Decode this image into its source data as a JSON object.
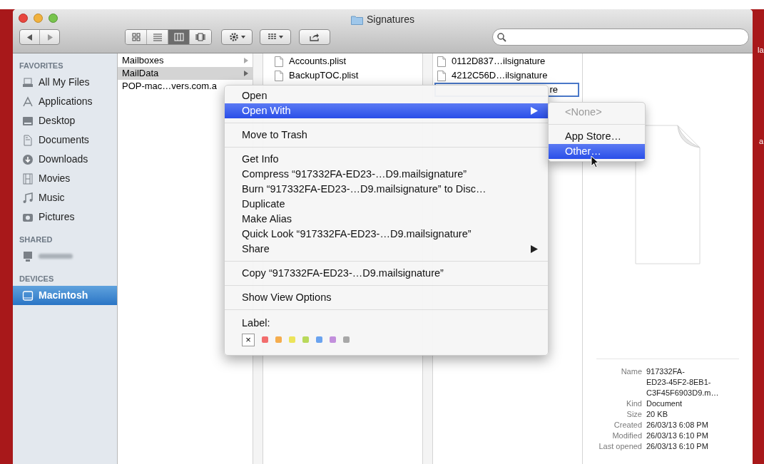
{
  "window": {
    "title": "Signatures"
  },
  "desktop_labels": [
    "la",
    "a"
  ],
  "toolbar": {
    "view_modes": [
      {
        "kind": "icons",
        "selected": false
      },
      {
        "kind": "list",
        "selected": false
      },
      {
        "kind": "columns",
        "selected": true
      },
      {
        "kind": "coverflow",
        "selected": false
      }
    ]
  },
  "sidebar": {
    "sections": [
      {
        "title": "FAVORITES",
        "items": [
          {
            "label": "All My Files",
            "kind": "files",
            "selected": false
          },
          {
            "label": "Applications",
            "kind": "apps",
            "selected": false
          },
          {
            "label": "Desktop",
            "kind": "desktop",
            "selected": false
          },
          {
            "label": "Documents",
            "kind": "documents",
            "selected": false
          },
          {
            "label": "Downloads",
            "kind": "downloads",
            "selected": false
          },
          {
            "label": "Movies",
            "kind": "movies",
            "selected": false
          },
          {
            "label": "Music",
            "kind": "music",
            "selected": false
          },
          {
            "label": "Pictures",
            "kind": "pictures",
            "selected": false
          }
        ]
      },
      {
        "title": "SHARED",
        "items": [
          {
            "kind": "computer",
            "blurred": true,
            "selected": false
          }
        ]
      },
      {
        "title": "DEVICES",
        "items": [
          {
            "label": "Macintosh",
            "kind": "disk",
            "selected": true
          }
        ]
      }
    ]
  },
  "columns": [
    {
      "items": [
        {
          "name": "Mailboxes",
          "folder": true,
          "selected": false
        },
        {
          "name": "MailData",
          "folder": true,
          "selected": true
        },
        {
          "name": "POP-mac…vers.com.a",
          "folder": false,
          "selected": false
        }
      ]
    },
    {
      "items": [
        {
          "name": "Accounts.plist",
          "selected": false
        },
        {
          "name": "BackupTOC.plist",
          "selected": false
        }
      ]
    },
    {
      "items": [
        {
          "name": "0112D837…ilsignature",
          "selected": false
        },
        {
          "name": "4212C56D…ilsignature",
          "selected": false
        },
        {
          "name": "re",
          "selected": true
        }
      ]
    }
  ],
  "context_menu": {
    "sections": [
      [
        {
          "label": "Open",
          "selected": false,
          "submenu": false
        },
        {
          "label": "Open With",
          "selected": true,
          "submenu": true
        }
      ],
      [
        {
          "label": "Move to Trash",
          "selected": false,
          "submenu": false
        }
      ],
      [
        {
          "label": "Get Info",
          "selected": false,
          "submenu": false
        },
        {
          "label": "Compress “917332FA-ED23-…D9.mailsignature”",
          "selected": false,
          "submenu": false
        },
        {
          "label": "Burn “917332FA-ED23-…D9.mailsignature” to Disc…",
          "selected": false,
          "submenu": false
        },
        {
          "label": "Duplicate",
          "selected": false,
          "submenu": false
        },
        {
          "label": "Make Alias",
          "selected": false,
          "submenu": false
        },
        {
          "label": "Quick Look “917332FA-ED23-…D9.mailsignature”",
          "selected": false,
          "submenu": false
        },
        {
          "label": "Share",
          "selected": false,
          "submenu": true
        }
      ],
      [
        {
          "label": "Copy “917332FA-ED23-…D9.mailsignature”",
          "selected": false,
          "submenu": false
        }
      ],
      [
        {
          "label": "Show View Options",
          "selected": false,
          "submenu": false
        }
      ]
    ],
    "label_title": "Label:",
    "label_none": "×",
    "label_colors": [
      {
        "color": "#f26d6d"
      },
      {
        "color": "#f5ad4e"
      },
      {
        "color": "#ece45a"
      },
      {
        "color": "#b9d95b"
      },
      {
        "color": "#6aa3ef"
      },
      {
        "color": "#c28fdc"
      },
      {
        "color": "#a8a8a8"
      }
    ]
  },
  "submenu": {
    "sections": [
      [
        {
          "label": "<None>",
          "disabled": true,
          "selected": false
        }
      ],
      [
        {
          "label": "App Store…",
          "disabled": false,
          "selected": false
        },
        {
          "label": "Other…",
          "disabled": false,
          "selected": true
        }
      ]
    ]
  },
  "preview": {
    "info": [
      {
        "key": "Name",
        "value": "917332FA-\nED23-45F2-8EB1-\nC3F45F6903D9.m…"
      },
      {
        "key": "Kind",
        "value": "Document"
      },
      {
        "key": "Size",
        "value": "20 KB"
      },
      {
        "key": "Created",
        "value": "26/03/13 6:08 PM"
      },
      {
        "key": "Modified",
        "value": "26/03/13 6:10 PM"
      },
      {
        "key": "Last opened",
        "value": "26/03/13 6:10 PM"
      }
    ]
  }
}
